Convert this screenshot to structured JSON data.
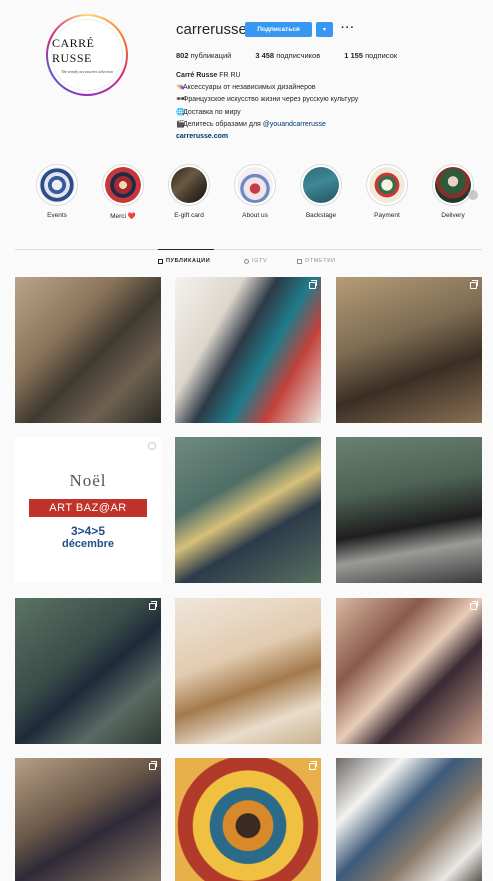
{
  "profile": {
    "avatar_logo_text": "CARRÉ RUSSE",
    "avatar_logo_sub": "The trendy accessories selection",
    "username": "carrerusse",
    "follow_label": "Подписаться",
    "dropdown_icon": "chevron-down-icon",
    "more_label": "···",
    "stats": [
      {
        "value": "802",
        "label": "публикаций"
      },
      {
        "value": "3 458",
        "label": "подписчиков"
      },
      {
        "value": "1 155",
        "label": "подписок"
      }
    ],
    "bio": {
      "name": "Carré Russe",
      "flags": "FR RU",
      "lines": [
        {
          "emoji": "👒",
          "text": "Аксессуары от независимых дизайнеров"
        },
        {
          "emoji": "🕶",
          "text": "Французское искусство жизни через русскую культуру"
        },
        {
          "emoji": "🌐",
          "text": "Доставка по миру"
        },
        {
          "emoji": "🎬",
          "text": "Делитесь образами для ",
          "mention": "@youandcarrerusse"
        }
      ],
      "website": "carrerusse.com"
    }
  },
  "highlights": [
    {
      "label": "Events"
    },
    {
      "label": "Merci ❤️"
    },
    {
      "label": "E-gift card"
    },
    {
      "label": "About us"
    },
    {
      "label": "Backstage"
    },
    {
      "label": "Payment"
    },
    {
      "label": "Delivery"
    }
  ],
  "tabs": [
    {
      "label": "ПУБЛИКАЦИИ",
      "icon": "grid-icon",
      "active": true
    },
    {
      "label": "IGTV",
      "icon": "igtv-icon",
      "active": false
    },
    {
      "label": "ОТМЕТКИ",
      "icon": "tag-icon",
      "active": false
    }
  ],
  "posts": {
    "noel": {
      "title": "Noël",
      "band": "ART BAZ@AR",
      "dates": "3>4>5",
      "month": "décembre"
    }
  },
  "colors": {
    "accent": "#3897f0",
    "link": "#00376b",
    "noel_red": "#c0322a",
    "noel_blue": "#1d4f8c"
  }
}
